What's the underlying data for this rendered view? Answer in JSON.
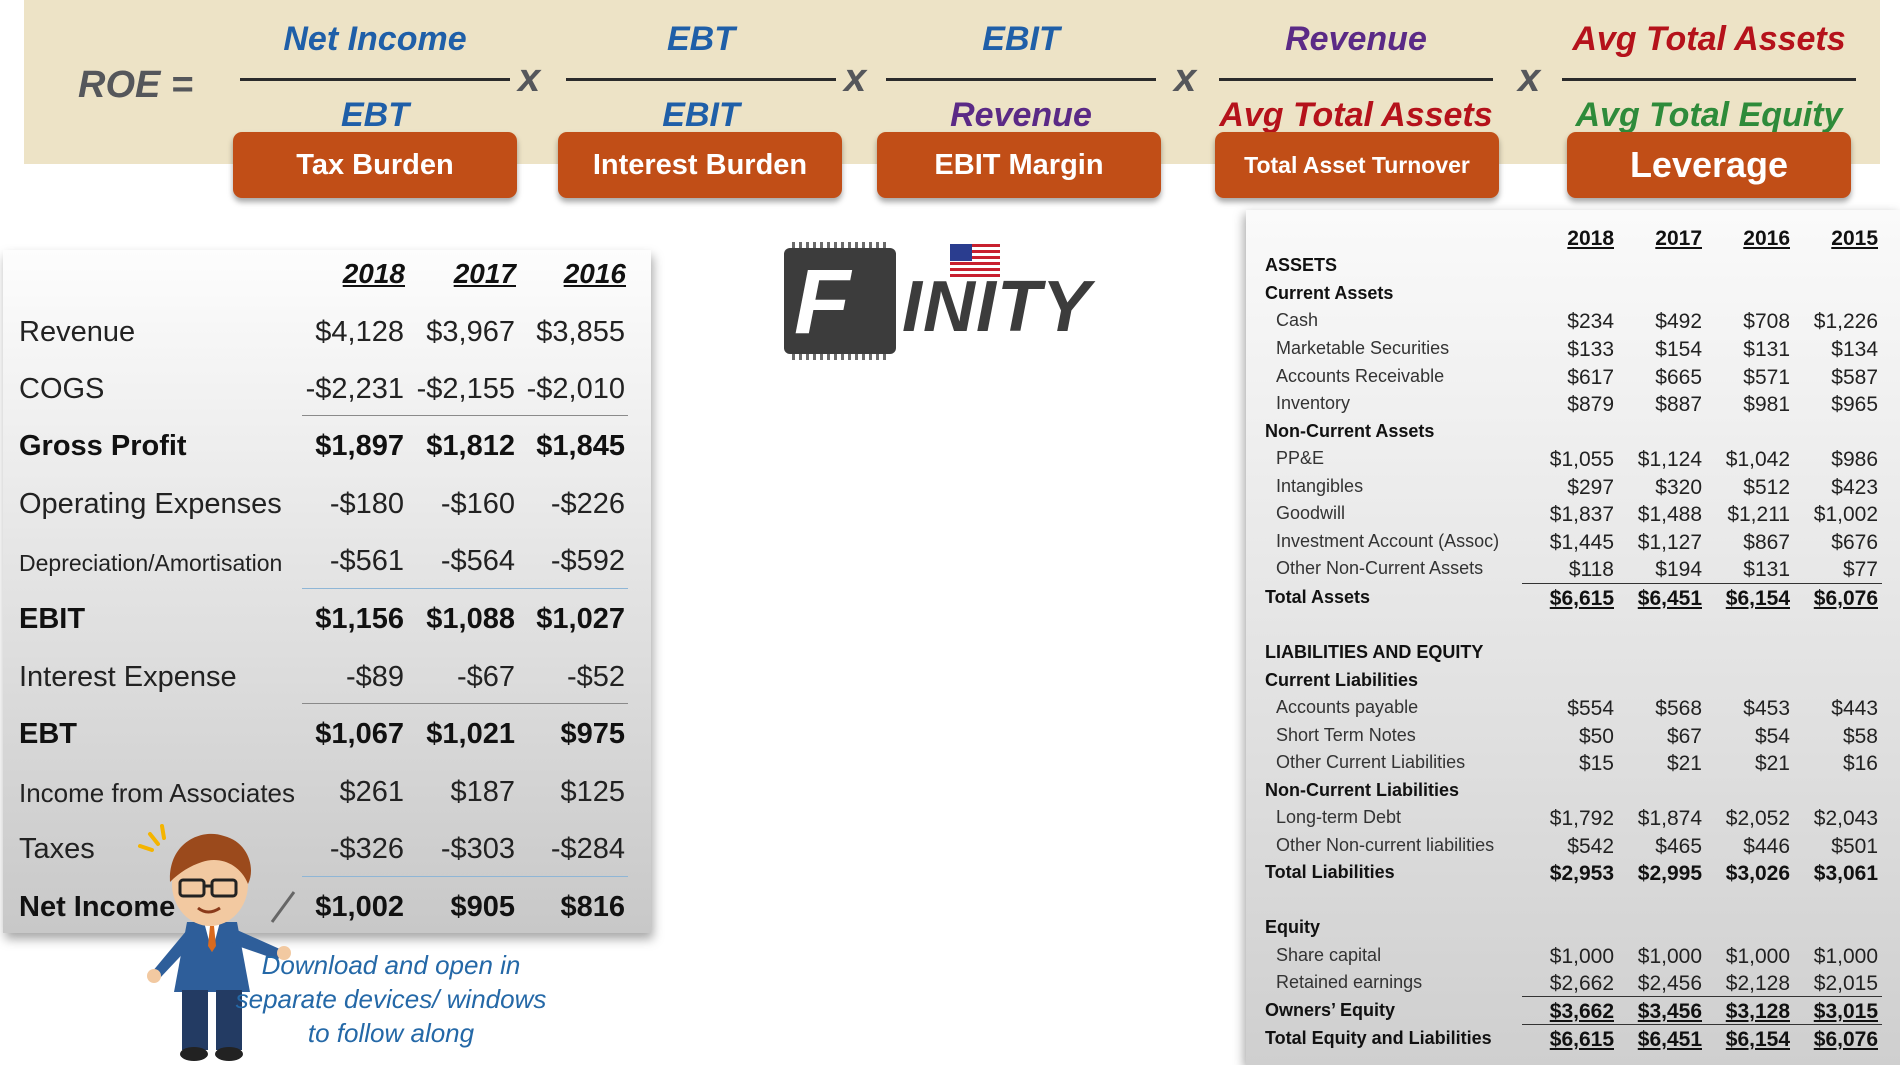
{
  "formula": {
    "label": "ROE =",
    "times": "x",
    "components": [
      {
        "numerator": "Net Income",
        "denominator": "EBT",
        "name": "Tax Burden",
        "num_color": "#1f5fa8",
        "den_color": "#1f5fa8"
      },
      {
        "numerator": "EBT",
        "denominator": "EBIT",
        "name": "Interest Burden",
        "num_color": "#1f5fa8",
        "den_color": "#1f5fa8"
      },
      {
        "numerator": "EBIT",
        "denominator": "Revenue",
        "name": "EBIT Margin",
        "num_color": "#1f5fa8",
        "den_color": "#5b2a86"
      },
      {
        "numerator": "Revenue",
        "denominator": "Avg Total Assets",
        "name": "Total Asset Turnover",
        "num_color": "#5b2a86",
        "den_color": "#b5121b"
      },
      {
        "numerator": "Avg Total Assets",
        "denominator": "Avg Total Equity",
        "name": "Leverage",
        "num_color": "#b5121b",
        "den_color": "#2e8b3a"
      }
    ]
  },
  "income_statement": {
    "years": [
      "2018",
      "2017",
      "2016"
    ],
    "rows": [
      {
        "label": "Revenue",
        "values": [
          "$4,128",
          "$3,967",
          "$3,855"
        ]
      },
      {
        "label": "COGS",
        "values": [
          "-$2,231",
          "-$2,155",
          "-$2,010"
        ]
      },
      {
        "label": "Gross Profit",
        "values": [
          "$1,897",
          "$1,812",
          "$1,845"
        ]
      },
      {
        "label": "Operating Expenses",
        "values": [
          "-$180",
          "-$160",
          "-$226"
        ]
      },
      {
        "label": "Depreciation/Amortisation",
        "values": [
          "-$561",
          "-$564",
          "-$592"
        ]
      },
      {
        "label": "EBIT",
        "values": [
          "$1,156",
          "$1,088",
          "$1,027"
        ]
      },
      {
        "label": "Interest Expense",
        "values": [
          "-$89",
          "-$67",
          "-$52"
        ]
      },
      {
        "label": "EBT",
        "values": [
          "$1,067",
          "$1,021",
          "$975"
        ]
      },
      {
        "label": "Income from Associates",
        "values": [
          "$261",
          "$187",
          "$125"
        ]
      },
      {
        "label": "Taxes",
        "values": [
          "-$326",
          "-$303",
          "-$284"
        ]
      },
      {
        "label": "Net Income",
        "values": [
          "$1,002",
          "$905",
          "$816"
        ]
      }
    ]
  },
  "logo": {
    "letter": "F",
    "text": "INITY"
  },
  "caption": "Download and open in separate devices/ windows to follow along",
  "balance_sheet": {
    "years": [
      "2018",
      "2017",
      "2016",
      "2015"
    ],
    "assets_header": "ASSETS",
    "current_assets": {
      "title": "Current Assets",
      "rows": [
        {
          "label": "Cash",
          "values": [
            "$234",
            "$492",
            "$708",
            "$1,226"
          ]
        },
        {
          "label": "Marketable Securities",
          "values": [
            "$133",
            "$154",
            "$131",
            "$134"
          ]
        },
        {
          "label": "Accounts Receivable",
          "values": [
            "$617",
            "$665",
            "$571",
            "$587"
          ]
        },
        {
          "label": "Inventory",
          "values": [
            "$879",
            "$887",
            "$981",
            "$965"
          ]
        }
      ]
    },
    "non_current_assets": {
      "title": "Non-Current Assets",
      "rows": [
        {
          "label": "PP&E",
          "values": [
            "$1,055",
            "$1,124",
            "$1,042",
            "$986"
          ]
        },
        {
          "label": "Intangibles",
          "values": [
            "$297",
            "$320",
            "$512",
            "$423"
          ]
        },
        {
          "label": "Goodwill",
          "values": [
            "$1,837",
            "$1,488",
            "$1,211",
            "$1,002"
          ]
        },
        {
          "label": "Investment Account (Assoc)",
          "values": [
            "$1,445",
            "$1,127",
            "$867",
            "$676"
          ]
        },
        {
          "label": "Other Non-Current Assets",
          "values": [
            "$118",
            "$194",
            "$131",
            "$77"
          ]
        }
      ]
    },
    "total_assets": {
      "label": "Total Assets",
      "values": [
        "$6,615",
        "$6,451",
        "$6,154",
        "$6,076"
      ]
    },
    "liab_header": "LIABILITIES AND EQUITY",
    "current_liabilities": {
      "title": "Current Liabilities",
      "rows": [
        {
          "label": "Accounts payable",
          "values": [
            "$554",
            "$568",
            "$453",
            "$443"
          ]
        },
        {
          "label": "Short Term Notes",
          "values": [
            "$50",
            "$67",
            "$54",
            "$58"
          ]
        },
        {
          "label": "Other Current Liabilities",
          "values": [
            "$15",
            "$21",
            "$21",
            "$16"
          ]
        }
      ]
    },
    "non_current_liabilities": {
      "title": "Non-Current Liabilities",
      "rows": [
        {
          "label": "Long-term Debt",
          "values": [
            "$1,792",
            "$1,874",
            "$2,052",
            "$2,043"
          ]
        },
        {
          "label": "Other Non-current liabilities",
          "values": [
            "$542",
            "$465",
            "$446",
            "$501"
          ]
        }
      ]
    },
    "total_liabilities": {
      "label": "Total Liabilities",
      "values": [
        "$2,953",
        "$2,995",
        "$3,026",
        "$3,061"
      ]
    },
    "equity": {
      "title": "Equity",
      "rows": [
        {
          "label": "Share capital",
          "values": [
            "$1,000",
            "$1,000",
            "$1,000",
            "$1,000"
          ]
        },
        {
          "label": "Retained earnings",
          "values": [
            "$2,662",
            "$2,456",
            "$2,128",
            "$2,015"
          ]
        }
      ]
    },
    "owners_equity": {
      "label": "Owners’ Equity",
      "values": [
        "$3,662",
        "$3,456",
        "$3,128",
        "$3,015"
      ]
    },
    "total_eq_liab": {
      "label": "Total Equity and Liabilities",
      "values": [
        "$6,615",
        "$6,451",
        "$6,154",
        "$6,076"
      ]
    }
  }
}
